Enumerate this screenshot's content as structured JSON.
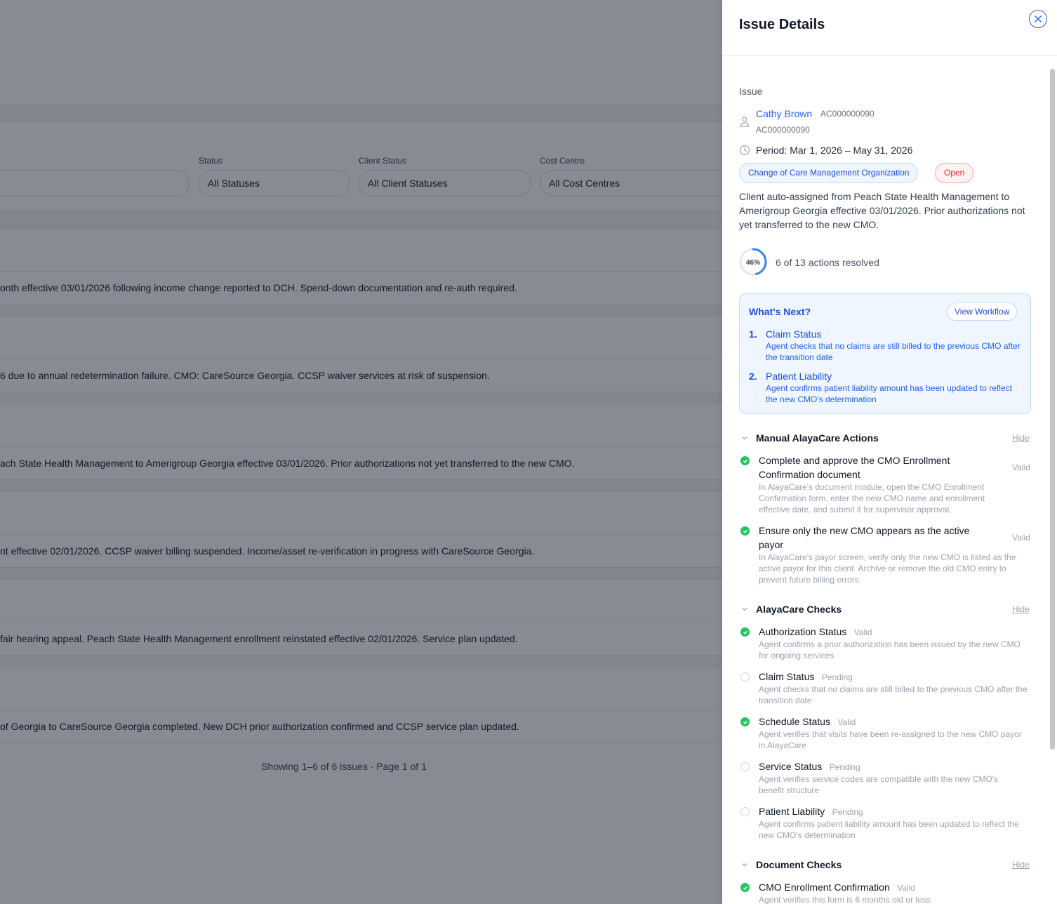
{
  "background": {
    "filters": [
      {
        "label": "Status",
        "value": "All Statuses"
      },
      {
        "label": "Client Status",
        "value": "All Client Statuses"
      },
      {
        "label": "Cost Centre",
        "value": "All Cost Centres"
      }
    ],
    "rows": [
      "onth effective 03/01/2026 following income change reported to DCH. Spend-down documentation and re-auth required.",
      "6 due to annual redetermination failure. CMO: CareSource Georgia. CCSP waiver services at risk of suspension.",
      "ach State Health Management to Amerigroup Georgia effective 03/01/2026. Prior authorizations not yet transferred to the new CMO.",
      "nt effective 02/01/2026. CCSP waiver billing suspended. Income/asset re-verification in progress with CareSource Georgia.",
      " fair hearing appeal. Peach State Health Management enrollment reinstated effective 02/01/2026. Service plan updated.",
      " of Georgia to CareSource Georgia completed. New DCH prior authorization confirmed and CCSP service plan updated."
    ],
    "pagination": "Showing 1–6 of 6 issues · Page 1 of 1"
  },
  "drawer": {
    "title": "Issue Details",
    "section_label": "Issue",
    "client": {
      "name": "Cathy Brown",
      "id": "AC000000090",
      "id_secondary": "AC000000090"
    },
    "period": "Period: Mar 1, 2026 – May 31, 2026",
    "tags": {
      "type": "Change of Care Management Organization",
      "status": "Open"
    },
    "summary": "Client auto-assigned from Peach State Health Management to Amerigroup Georgia effective 03/01/2026. Prior authorizations not yet transferred to the new CMO.",
    "progress": {
      "percent_label": "46%",
      "fraction": 0.46,
      "text": "6 of 13 actions resolved"
    },
    "whats_next": {
      "title": "What's Next?",
      "button": "View Workflow",
      "steps": [
        {
          "num": "1.",
          "title": "Claim Status",
          "desc": "Agent checks that no claims are still billed to the previous CMO after the transition date"
        },
        {
          "num": "2.",
          "title": "Patient Liability",
          "desc": "Agent confirms patient liability amount has been updated to reflect the new CMO's determination"
        }
      ]
    },
    "hide_label": "Hide",
    "groups": {
      "manual": {
        "title": "Manual AlayaCare Actions",
        "items": [
          {
            "title": "Complete and approve the CMO Enrollment Confirmation document",
            "status": "Valid",
            "desc": "In AlayaCare's document module, open the CMO Enrollment Confirmation form, enter the new CMO name and enrollment effective date, and submit it for supervisor approval."
          },
          {
            "title": "Ensure only the new CMO appears as the active payor",
            "status": "Valid",
            "desc": "In AlayaCare's payor screen, verify only the new CMO is listed as the active payor for this client. Archive or remove the old CMO entry to prevent future billing errors."
          }
        ]
      },
      "checks": {
        "title": "AlayaCare Checks",
        "items": [
          {
            "title": "Authorization Status",
            "status": "Valid",
            "desc": "Agent confirms a prior authorization has been issued by the new CMO for ongoing services"
          },
          {
            "title": "Claim Status",
            "status": "Pending",
            "desc": "Agent checks that no claims are still billed to the previous CMO after the transition date"
          },
          {
            "title": "Schedule Status",
            "status": "Valid",
            "desc": "Agent verifies that visits have been re-assigned to the new CMO payor in AlayaCare"
          },
          {
            "title": "Service Status",
            "status": "Pending",
            "desc": "Agent verifies service codes are compatible with the new CMO's benefit structure"
          },
          {
            "title": "Patient Liability",
            "status": "Pending",
            "desc": "Agent confirms patient liability amount has been updated to reflect the new CMO's determination"
          }
        ]
      },
      "documents": {
        "title": "Document Checks",
        "items": [
          {
            "title": "CMO Enrollment Confirmation",
            "status": "Valid",
            "desc": "Agent verifies this form is 6 months old or less"
          }
        ]
      }
    },
    "colors": {
      "accent": "#2563eb",
      "valid": "#22c55e",
      "open": "#dc2626",
      "overlay": "rgba(17,24,39,0.5)"
    }
  }
}
